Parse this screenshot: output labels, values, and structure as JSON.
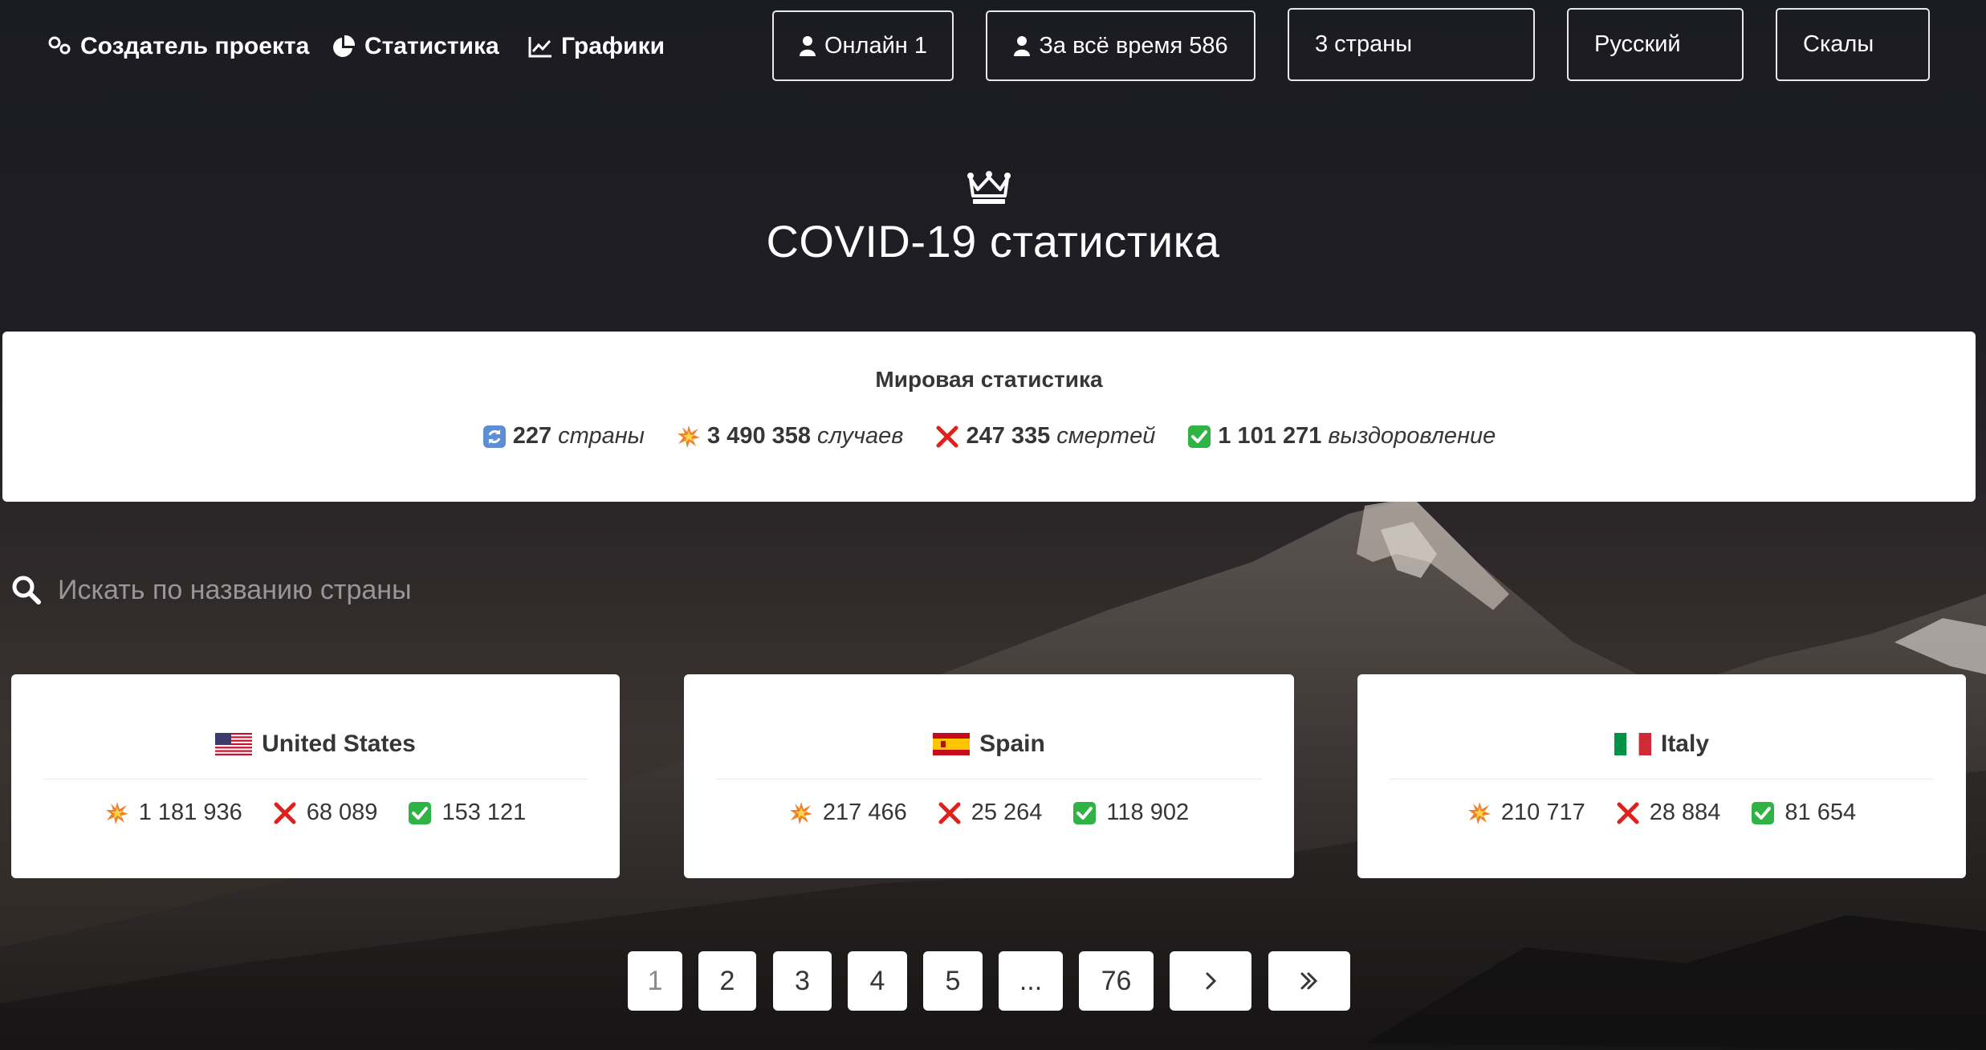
{
  "nav": {
    "creator": "Создатель проекта",
    "stats": "Статистика",
    "charts": "Графики",
    "online_label": "Онлайн",
    "online_count": "1",
    "alltime_label": "За всё время",
    "alltime_count": "586",
    "countries_select": "3 страны",
    "language_select": "Русский",
    "theme_select": "Скалы"
  },
  "header": {
    "icon": "crown-icon",
    "title": "COVID-19 статистика"
  },
  "world": {
    "heading": "Мировая статистика",
    "countries_value": "227",
    "countries_label": "страны",
    "cases_value": "3 490 358",
    "cases_label": "случаев",
    "deaths_value": "247 335",
    "deaths_label": "смертей",
    "recovered_value": "1 101 271",
    "recovered_label": "выздоровление"
  },
  "search": {
    "placeholder": "Искать по названию страны",
    "value": ""
  },
  "countries": [
    {
      "name": "United States",
      "flag": "us-flag",
      "cases": "1 181 936",
      "deaths": "68 089",
      "recovered": "153 121"
    },
    {
      "name": "Spain",
      "flag": "es-flag",
      "cases": "217 466",
      "deaths": "25 264",
      "recovered": "118 902"
    },
    {
      "name": "Italy",
      "flag": "it-flag",
      "cases": "210 717",
      "deaths": "28 884",
      "recovered": "81 654"
    }
  ],
  "pagination": {
    "pages": [
      "1",
      "2",
      "3",
      "4",
      "5",
      "...",
      "76"
    ],
    "current": "1",
    "next_icon": "chevron-right-icon",
    "last_icon": "double-chevron-right-icon"
  },
  "colors": {
    "background": "#1b1b22",
    "card": "#ffffff",
    "text_dark": "#363636",
    "deaths_red": "#e0211b",
    "recovered_green": "#2fb344"
  }
}
